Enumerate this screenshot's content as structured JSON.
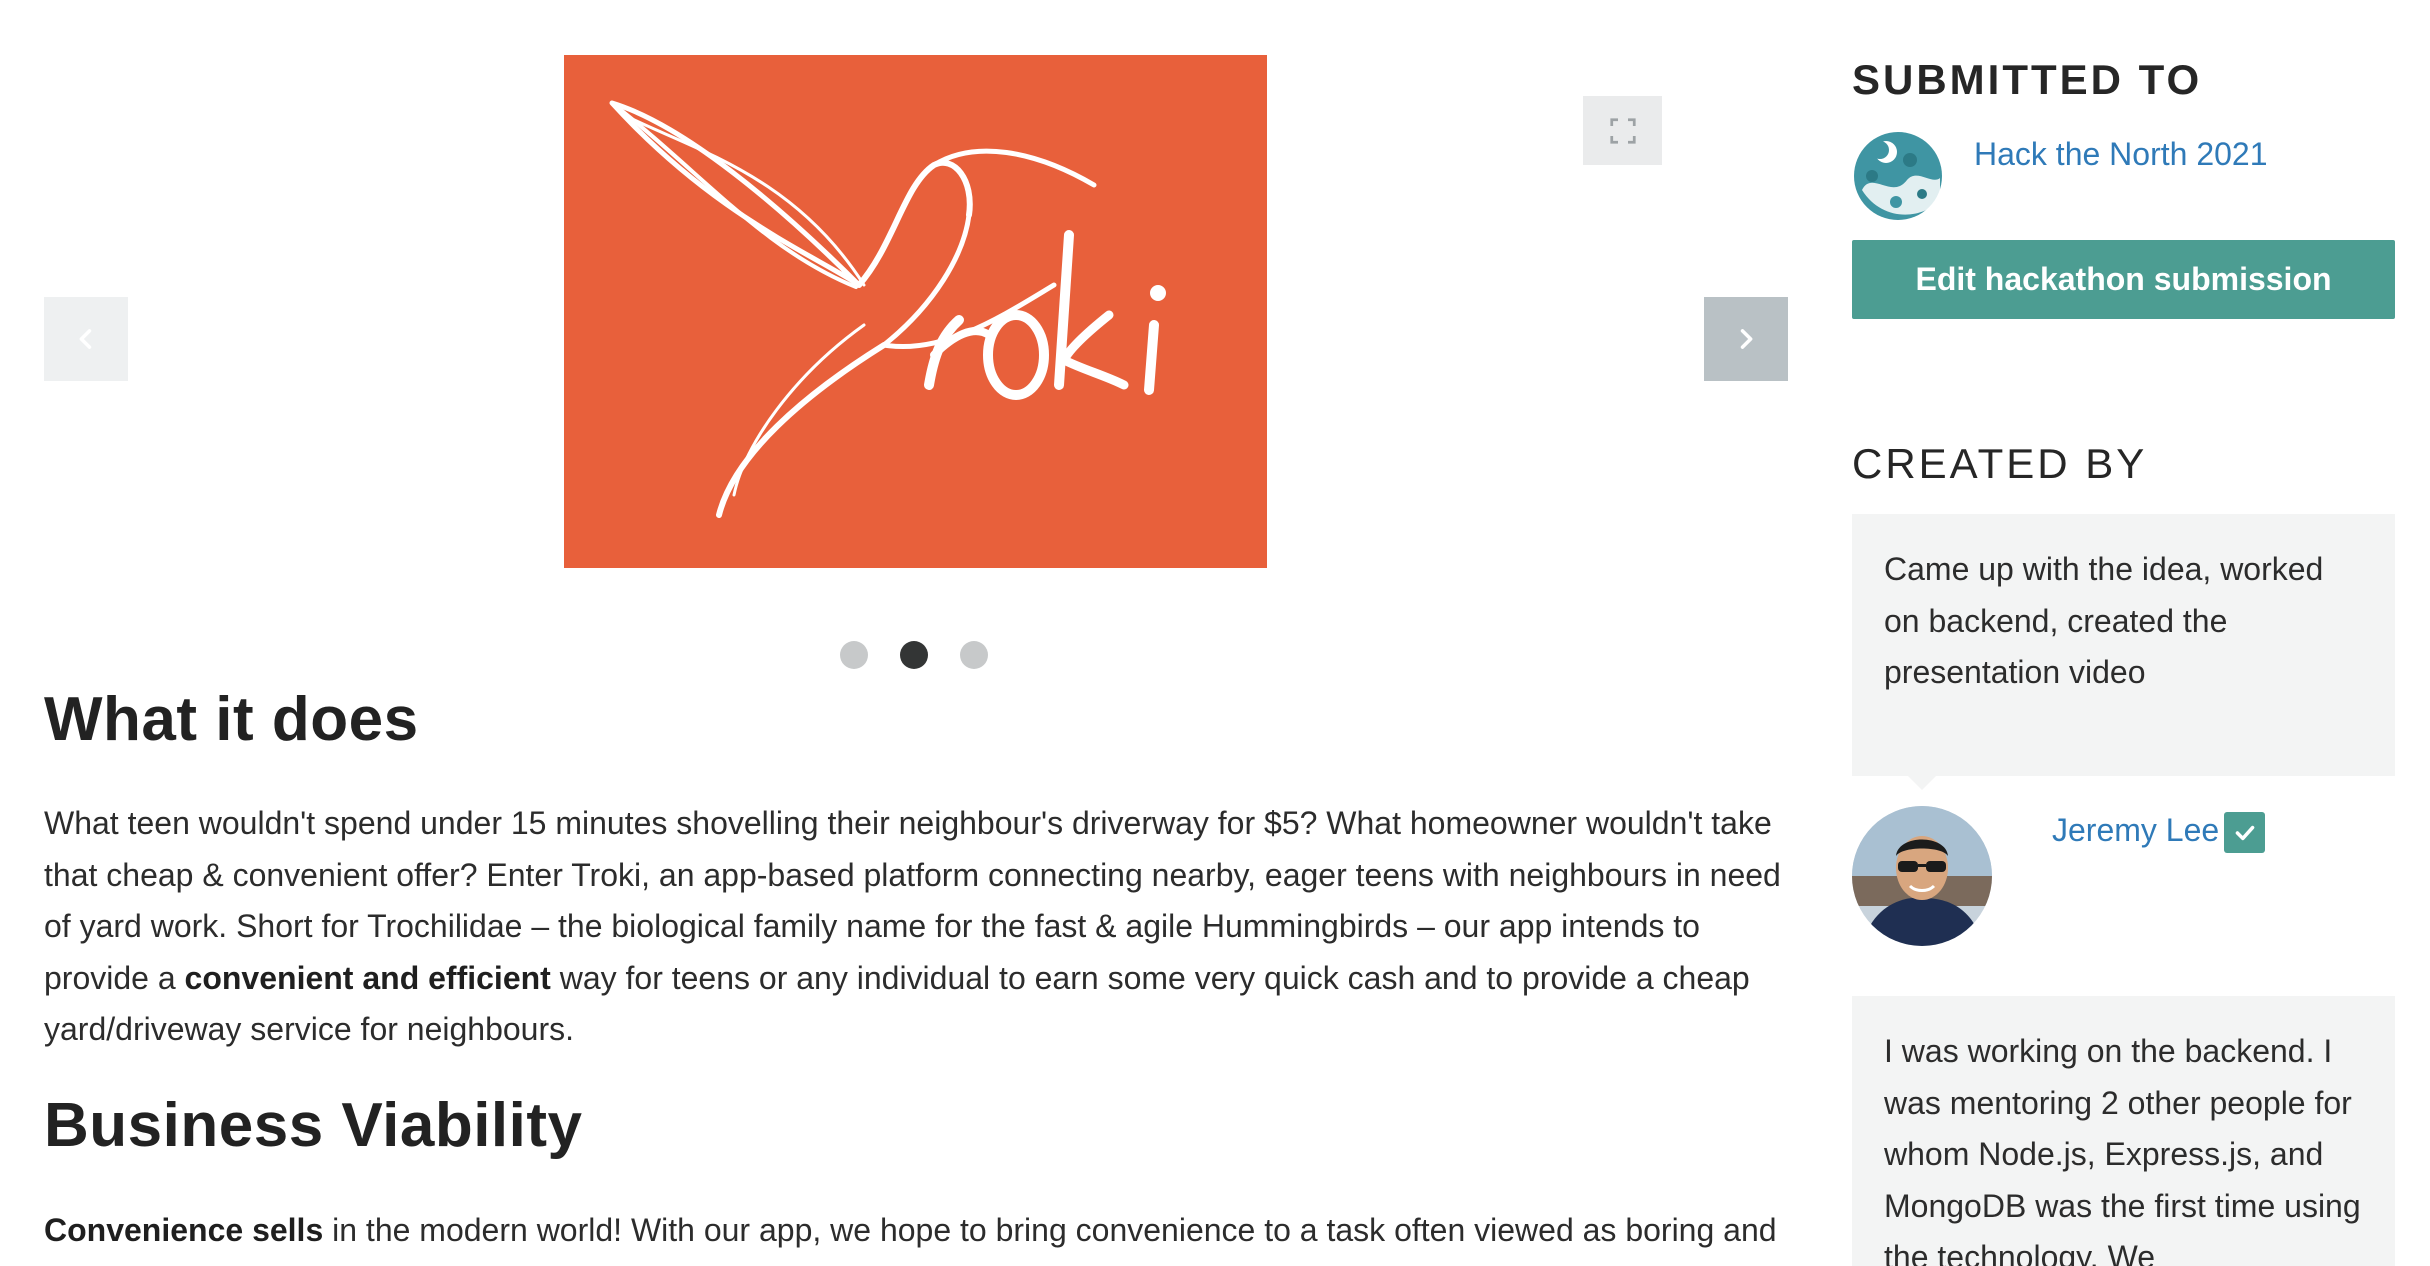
{
  "gallery": {
    "logo_text": "Troki",
    "dots": [
      "slide-1",
      "slide-2",
      "slide-3"
    ],
    "active_dot": 1
  },
  "article": {
    "heading_what": "What it does",
    "para_what_1": "What teen wouldn't spend under 15 minutes shovelling their neighbour's driverway for $5? What homeowner wouldn't take that cheap & convenient offer? Enter Troki, an app-based platform connecting nearby, eager teens with neighbours in need of yard work. Short for Trochilidae – the biological family name for the fast & agile Hummingbirds – our app intends to provide a ",
    "para_what_bold": "convenient and efficient",
    "para_what_2": " way for teens or any individual to earn some very quick cash and to provide a cheap yard/driveway service for neighbours.",
    "heading_biz": "Business Viability",
    "para_biz_bold": "Convenience sells",
    "para_biz_rest": " in the modern world! With our app, we hope to bring convenience to a task often viewed as boring and"
  },
  "sidebar": {
    "submitted_title": "SUBMITTED TO",
    "hackathon_name": "Hack the North 2021",
    "edit_button": "Edit hackathon submission",
    "created_title": "CREATED BY",
    "member_1_contribution": "Came up with the idea, worked on backend, created the presentation video",
    "member_1_name": "Jeremy Lee",
    "member_2_contribution": "I was working on the backend. I was mentoring 2 other people for whom Node.js, Express.js, and MongoDB was the first time using the technology. We"
  },
  "colors": {
    "logo_bg": "#e8603b",
    "accent": "#4c9d92",
    "link": "#2f7ab8"
  },
  "icons": {
    "prev": "chevron-left-icon",
    "next": "chevron-right-icon",
    "fullscreen": "fullscreen-icon",
    "verified": "checkmark-icon"
  }
}
